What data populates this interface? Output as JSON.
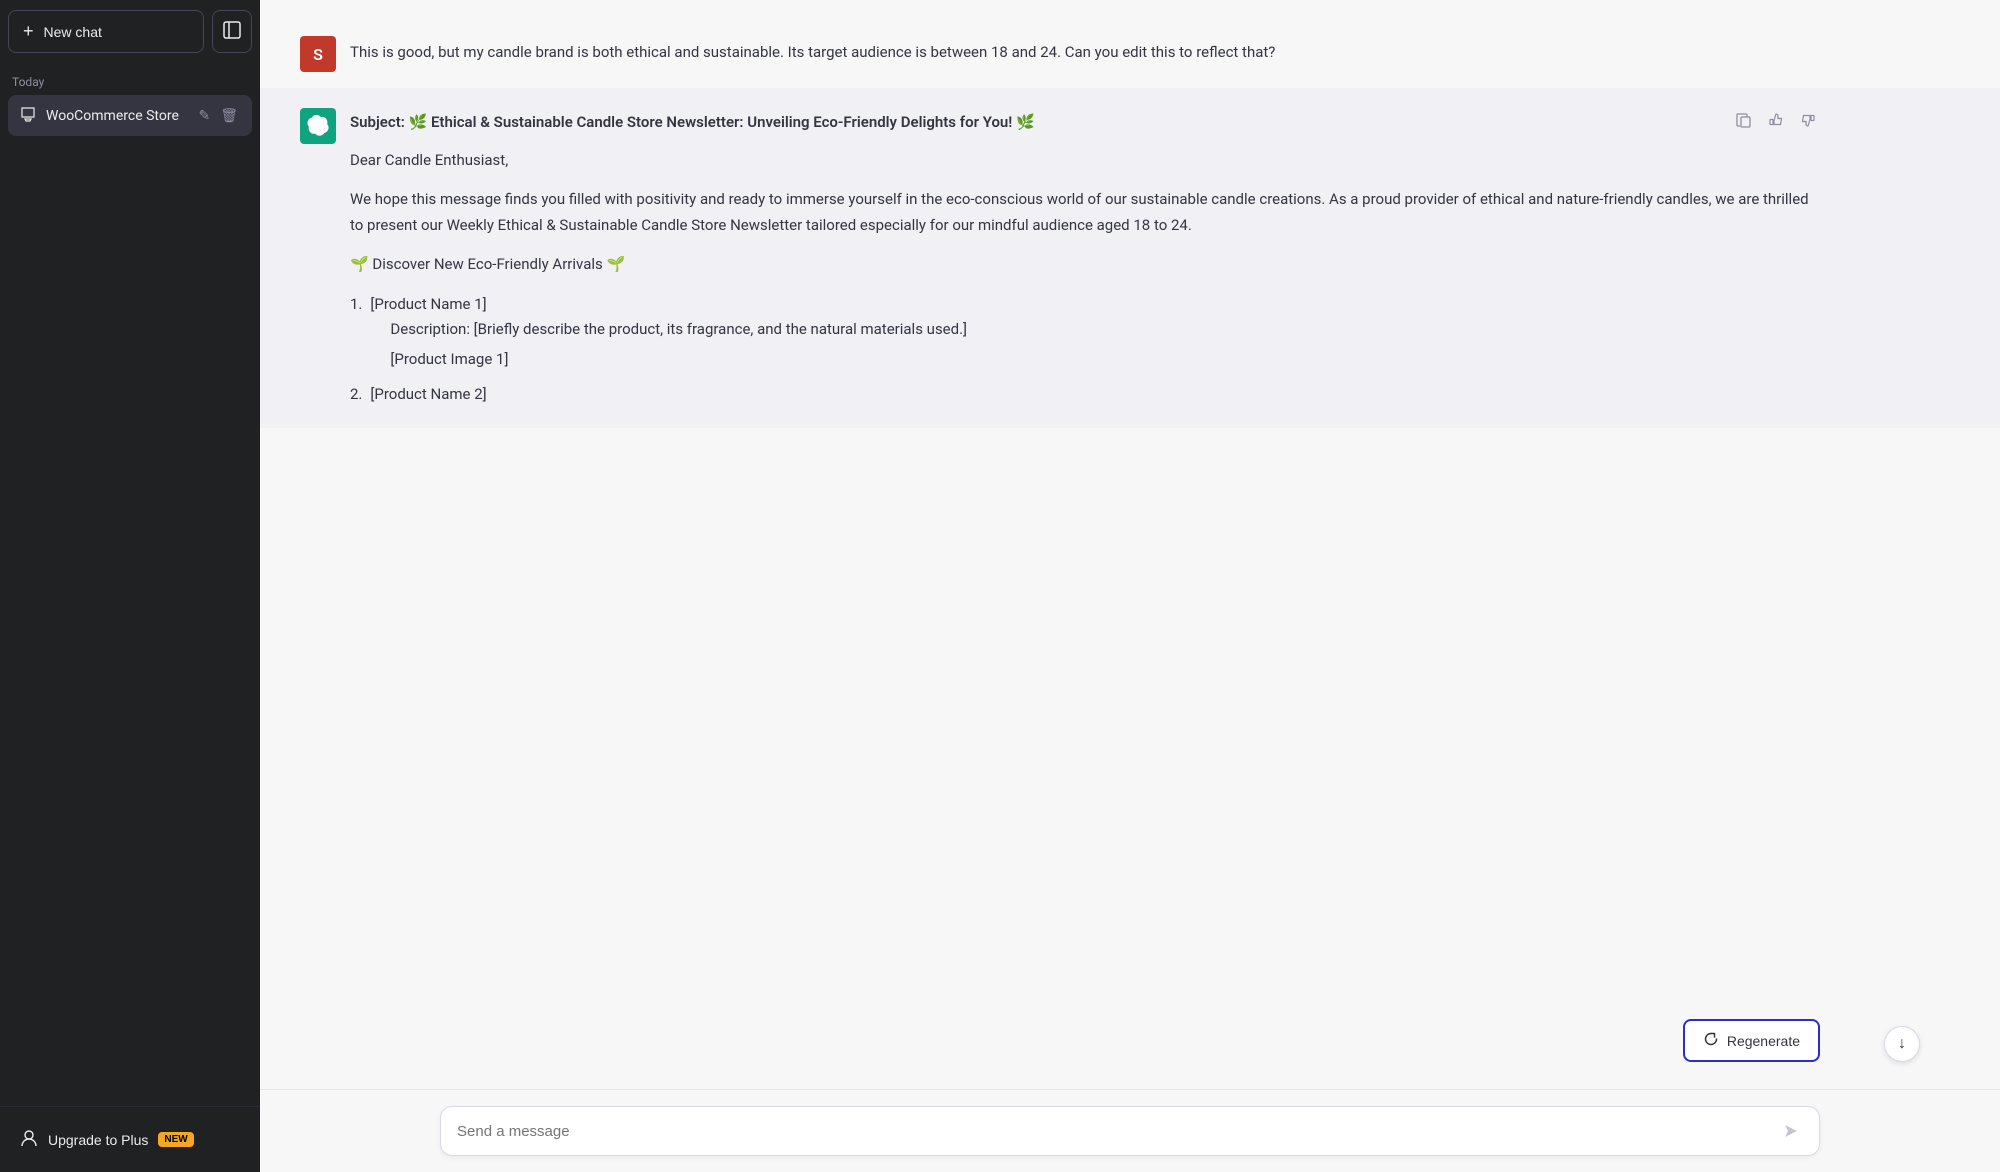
{
  "sidebar": {
    "new_chat_label": "New chat",
    "today_label": "Today",
    "chat_item_label": "WooCommerce Store",
    "upgrade_label": "Upgrade to Plus",
    "upgrade_badge": "NEW"
  },
  "messages": [
    {
      "type": "user",
      "avatar": "S",
      "text": "This is good, but my candle brand is both ethical and sustainable. Its target audience is between 18 and 24. Can you edit this to reflect that?"
    },
    {
      "type": "ai",
      "subject": "Subject: 🌿 Ethical & Sustainable Candle Store Newsletter: Unveiling Eco-Friendly Delights for You! 🌿",
      "greeting": "Dear Candle Enthusiast,",
      "intro": "We hope this message finds you filled with positivity and ready to immerse yourself in the eco-conscious world of our sustainable candle creations. As a proud provider of ethical and nature-friendly candles, we are thrilled to present our Weekly Ethical & Sustainable Candle Store Newsletter tailored especially for our mindful audience aged 18 to 24.",
      "section_title": "🌱 Discover New Eco-Friendly Arrivals 🌱",
      "products": [
        {
          "number": "1.",
          "name": "[Product Name 1]",
          "description": "Description: [Briefly describe the product, its fragrance, and the natural materials used.]",
          "image": "[Product Image 1]"
        },
        {
          "number": "2.",
          "name": "[Product Name 2]"
        }
      ]
    }
  ],
  "input": {
    "placeholder": "Send a message"
  },
  "buttons": {
    "regenerate": "Regenerate"
  }
}
